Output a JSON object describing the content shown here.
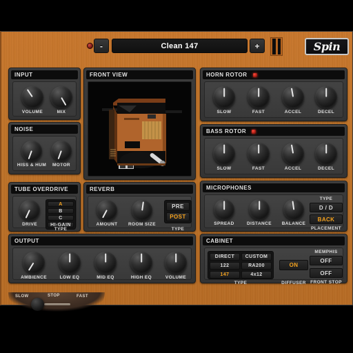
{
  "app": {
    "title": "Spin",
    "logo_text": "Spin"
  },
  "topbar": {
    "preset_name": "Clean 147",
    "prev_label": "-",
    "next_label": "+",
    "led_name": "preset-led"
  },
  "panels": {
    "input": {
      "title": "INPUT",
      "knobs": [
        {
          "label": "VOLUME",
          "angle": -34
        },
        {
          "label": "MIX",
          "angle": 150
        }
      ]
    },
    "noise": {
      "title": "NOISE",
      "knobs": [
        {
          "label": "HISS & HUM",
          "angle": 200
        },
        {
          "label": "MOTOR",
          "angle": 200
        }
      ]
    },
    "front_view": {
      "title": "FRONT VIEW"
    },
    "tube_overdrive": {
      "title": "TUBE OVERDRIVE",
      "knobs": [
        {
          "label": "DRIVE",
          "angle": 205
        }
      ],
      "type_label": "TYPE",
      "types": [
        {
          "label": "A",
          "selected": true
        },
        {
          "label": "B",
          "selected": false
        },
        {
          "label": "C",
          "selected": false
        },
        {
          "label": "HI-GAIN",
          "selected": false
        }
      ]
    },
    "reverb": {
      "title": "REVERB",
      "knobs": [
        {
          "label": "AMOUNT",
          "angle": 208
        },
        {
          "label": "ROOM SIZE",
          "angle": 8
        }
      ],
      "type_label": "TYPE",
      "types": [
        {
          "label": "PRE",
          "selected": false
        },
        {
          "label": "POST",
          "selected": true
        }
      ]
    },
    "output": {
      "title": "OUTPUT",
      "knobs": [
        {
          "label": "AMBIENCE",
          "angle": 212
        },
        {
          "label": "LOW EQ",
          "angle": 0
        },
        {
          "label": "MID EQ",
          "angle": 0
        },
        {
          "label": "HIGH EQ",
          "angle": 0
        },
        {
          "label": "VOLUME",
          "angle": 0
        }
      ]
    },
    "horn_rotor": {
      "title": "HORN ROTOR",
      "led": true,
      "knobs": [
        {
          "label": "SLOW",
          "angle": 0
        },
        {
          "label": "FAST",
          "angle": 0
        },
        {
          "label": "ACCEL",
          "angle": -10
        },
        {
          "label": "DECEL",
          "angle": 0
        }
      ]
    },
    "bass_rotor": {
      "title": "BASS ROTOR",
      "led": true,
      "knobs": [
        {
          "label": "SLOW",
          "angle": 0
        },
        {
          "label": "FAST",
          "angle": 0
        },
        {
          "label": "ACCEL",
          "angle": -10
        },
        {
          "label": "DECEL",
          "angle": 0
        }
      ]
    },
    "microphones": {
      "title": "MICROPHONES",
      "knobs": [
        {
          "label": "SPREAD",
          "angle": 0
        },
        {
          "label": "DISTANCE",
          "angle": 0
        },
        {
          "label": "BALANCE",
          "angle": -8
        }
      ],
      "type_label": "TYPE",
      "type_value": "D / D",
      "placement_label": "PLACEMENT",
      "placement_value": "BACK"
    },
    "cabinet": {
      "title": "CABINET",
      "type_label": "TYPE",
      "types": [
        {
          "label": "DIRECT",
          "selected": false
        },
        {
          "label": "CUSTOM",
          "selected": false
        },
        {
          "label": "122",
          "selected": false
        },
        {
          "label": "RA200",
          "selected": false
        },
        {
          "label": "147",
          "selected": true
        },
        {
          "label": "4x12",
          "selected": false
        }
      ],
      "diffuser_label": "DIFFUSER",
      "diffuser_value": "ON",
      "memphis_label": "MEMPHIS",
      "memphis_value": "OFF",
      "front_stop_label": "FRONT STOP",
      "front_stop_value": "OFF"
    }
  },
  "lever": {
    "slow_label": "SLOW",
    "stop_label": "STOP",
    "fast_label": "FAST"
  },
  "colors": {
    "accent": "#f5a21e",
    "wood": "#c0742a",
    "panel": "#3a3a3a",
    "led_red": "#ff4a3a"
  }
}
